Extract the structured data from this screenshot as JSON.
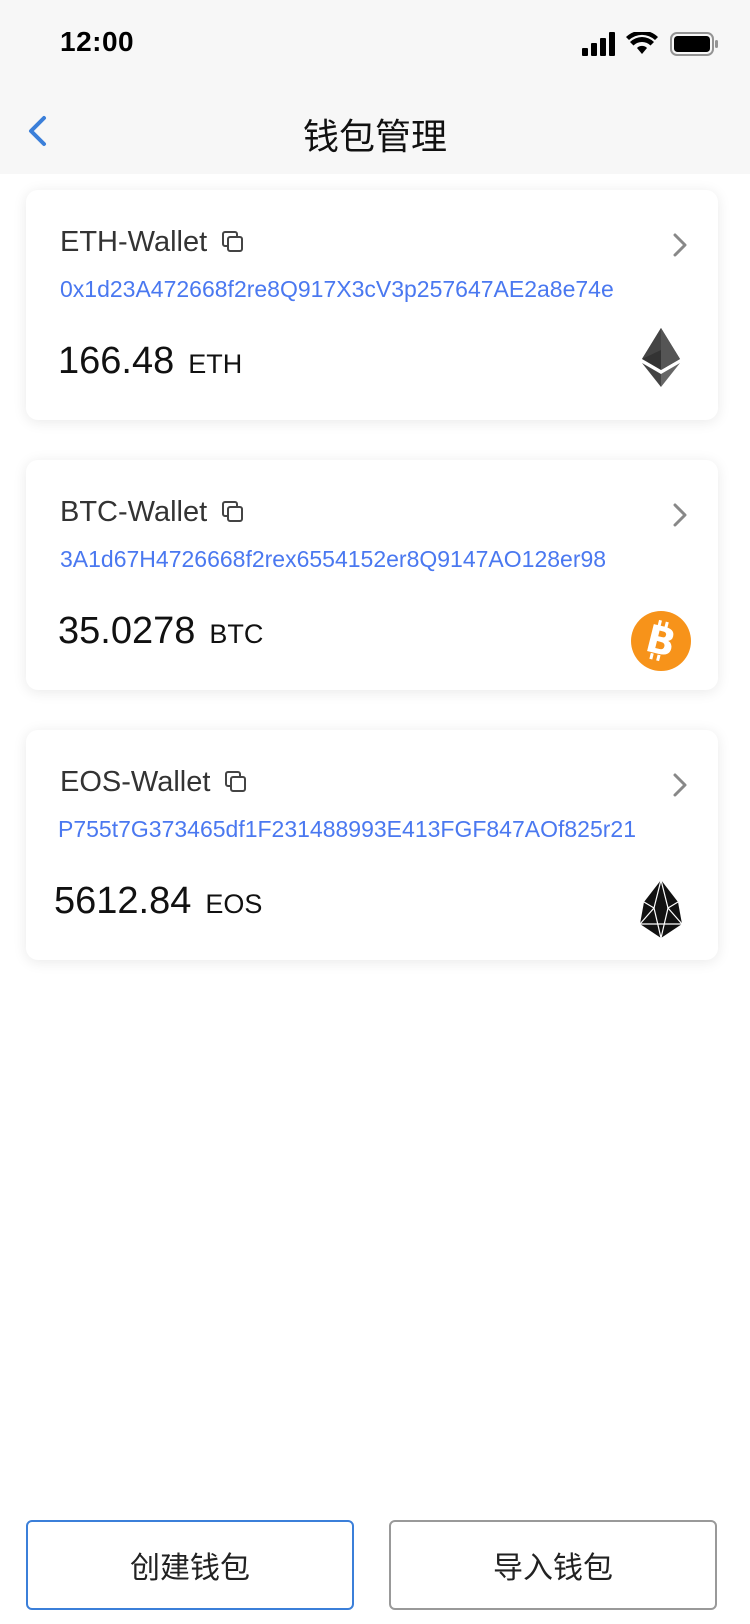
{
  "status_bar": {
    "time": "12:00",
    "icons": [
      "signal-icon",
      "wifi-icon",
      "battery-icon"
    ]
  },
  "nav": {
    "title": "钱包管理",
    "back_icon": "chevron-left-icon",
    "accent_color": "#3b7fd9"
  },
  "wallets": [
    {
      "name": "ETH-Wallet",
      "address": "0x1d23A472668f2re8Q917X3cV3p257647AE2a8e74e",
      "amount": "166.48",
      "unit": "ETH",
      "icon": "ethereum-icon"
    },
    {
      "name": "BTC-Wallet",
      "address": "3A1d67H4726668f2rex6554152er8Q9147AO128er98",
      "amount": "35.0278",
      "unit": "BTC",
      "icon": "bitcoin-icon",
      "icon_color": "#f7931a"
    },
    {
      "name": "EOS-Wallet",
      "address": "P755t7G373465df1F231488993E413FGF847AOf825r21",
      "amount": "5612.84",
      "unit": "EOS",
      "icon": "eos-icon"
    }
  ],
  "footer": {
    "create_label": "创建钱包",
    "import_label": "导入钱包"
  },
  "colors": {
    "address": "#4a78f0",
    "background_bar": "#f7f7f7"
  }
}
